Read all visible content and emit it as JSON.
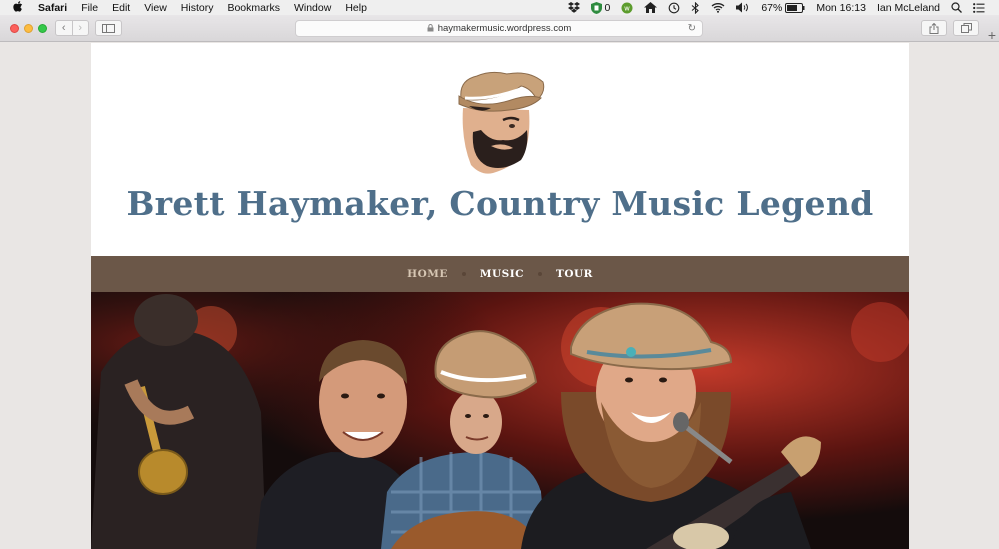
{
  "menubar": {
    "app": "Safari",
    "items": [
      "File",
      "Edit",
      "View",
      "History",
      "Bookmarks",
      "Window",
      "Help"
    ],
    "tray": {
      "adblock_count": "0",
      "battery": "67%",
      "clock": "Mon 16:13",
      "user": "Ian McLeland"
    }
  },
  "browser": {
    "url": "haymakermusic.wordpress.com"
  },
  "site": {
    "title": "Brett Haymaker, Country Music Legend",
    "nav": [
      {
        "label": "HOME",
        "current": true
      },
      {
        "label": "MUSIC",
        "current": false
      },
      {
        "label": "TOUR",
        "current": false
      }
    ]
  },
  "colors": {
    "title": "#4f6f8a",
    "nav_bg": "#6b5748",
    "nav_current": "#d6c6b3"
  }
}
